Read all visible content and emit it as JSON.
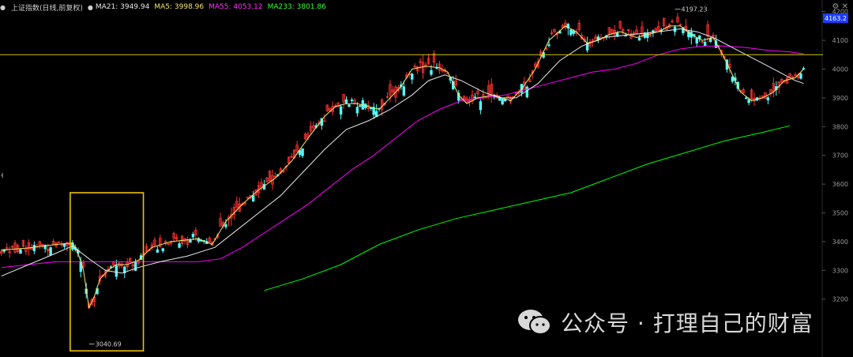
{
  "header": {
    "title": "上证指数(日线,前复权)",
    "ma21": "MA21: 3949.94",
    "ma5": "MA5: 3998.96",
    "ma55": "MA55: 4053.12",
    "ma233": "MA233: 3801.86"
  },
  "colors": {
    "background": "#000000",
    "up": "#ff3232",
    "down": "#54ffff",
    "ma5": "#f3e66c",
    "ma21": "#e8e8e8",
    "ma55": "#ff00ff",
    "ma233": "#00ff00",
    "hline": "#d6c900",
    "box": "#f0c000",
    "price_badge": "#1b3dff"
  },
  "watermark": "公众号 · 打理自己的财富",
  "chart_data": {
    "type": "candlestick",
    "title": "上证指数(日线,前复权)",
    "y_ticks": [
      3200,
      3300,
      3400,
      3500,
      3600,
      3700,
      3800,
      3900,
      4000,
      4100,
      4200
    ],
    "ylim": [
      3130,
      4230
    ],
    "current_price": "4163.2",
    "horizontal_line": 4050,
    "annotations": [
      {
        "text": "4197.23",
        "x": 246,
        "value": 4197.23
      },
      {
        "text": "3040.69",
        "x": 32,
        "value": 3040.69
      }
    ],
    "highlight_box": {
      "x_start": 26,
      "x_end": 51,
      "y_low": 3020,
      "y_high": 3570
    },
    "ma5_path": [
      [
        0,
        3370
      ],
      [
        10,
        3378
      ],
      [
        20,
        3390
      ],
      [
        26,
        3395
      ],
      [
        28,
        3360
      ],
      [
        30,
        3300
      ],
      [
        32,
        3170
      ],
      [
        34,
        3210
      ],
      [
        36,
        3270
      ],
      [
        39,
        3300
      ],
      [
        42,
        3320
      ],
      [
        46,
        3320
      ],
      [
        50,
        3335
      ],
      [
        55,
        3380
      ],
      [
        62,
        3400
      ],
      [
        72,
        3410
      ],
      [
        77,
        3390
      ],
      [
        82,
        3470
      ],
      [
        88,
        3530
      ],
      [
        94,
        3580
      ],
      [
        100,
        3620
      ],
      [
        106,
        3680
      ],
      [
        112,
        3760
      ],
      [
        118,
        3835
      ],
      [
        122,
        3870
      ],
      [
        126,
        3880
      ],
      [
        130,
        3880
      ],
      [
        134,
        3870
      ],
      [
        138,
        3860
      ],
      [
        142,
        3900
      ],
      [
        146,
        3940
      ],
      [
        150,
        4000
      ],
      [
        155,
        4010
      ],
      [
        160,
        4005
      ],
      [
        163,
        3990
      ],
      [
        167,
        3910
      ],
      [
        170,
        3880
      ],
      [
        174,
        3900
      ],
      [
        180,
        3910
      ],
      [
        186,
        3890
      ],
      [
        190,
        3930
      ],
      [
        195,
        4000
      ],
      [
        200,
        4100
      ],
      [
        206,
        4150
      ],
      [
        210,
        4130
      ],
      [
        214,
        4090
      ],
      [
        218,
        4100
      ],
      [
        222,
        4120
      ],
      [
        226,
        4130
      ],
      [
        232,
        4110
      ],
      [
        240,
        4130
      ],
      [
        244,
        4150
      ],
      [
        248,
        4150
      ],
      [
        252,
        4120
      ],
      [
        256,
        4100
      ],
      [
        260,
        4110
      ],
      [
        264,
        4040
      ],
      [
        266,
        4000
      ],
      [
        270,
        3920
      ],
      [
        274,
        3890
      ],
      [
        278,
        3900
      ],
      [
        282,
        3920
      ],
      [
        286,
        3960
      ],
      [
        290,
        3970
      ],
      [
        293,
        4000
      ]
    ],
    "ma21_path": [
      [
        0,
        3280
      ],
      [
        10,
        3320
      ],
      [
        20,
        3360
      ],
      [
        26,
        3385
      ],
      [
        32,
        3340
      ],
      [
        38,
        3300
      ],
      [
        44,
        3290
      ],
      [
        50,
        3310
      ],
      [
        58,
        3330
      ],
      [
        68,
        3350
      ],
      [
        78,
        3380
      ],
      [
        86,
        3440
      ],
      [
        94,
        3500
      ],
      [
        102,
        3560
      ],
      [
        110,
        3640
      ],
      [
        118,
        3720
      ],
      [
        126,
        3790
      ],
      [
        134,
        3820
      ],
      [
        142,
        3860
      ],
      [
        150,
        3910
      ],
      [
        156,
        3960
      ],
      [
        162,
        3980
      ],
      [
        168,
        3960
      ],
      [
        176,
        3920
      ],
      [
        182,
        3900
      ],
      [
        188,
        3900
      ],
      [
        196,
        3950
      ],
      [
        204,
        4030
      ],
      [
        212,
        4080
      ],
      [
        220,
        4110
      ],
      [
        230,
        4120
      ],
      [
        240,
        4130
      ],
      [
        248,
        4140
      ],
      [
        254,
        4130
      ],
      [
        260,
        4110
      ],
      [
        266,
        4080
      ],
      [
        272,
        4050
      ],
      [
        278,
        4020
      ],
      [
        284,
        3990
      ],
      [
        290,
        3960
      ],
      [
        293,
        3950
      ]
    ],
    "ma55_path": [
      [
        0,
        3310
      ],
      [
        10,
        3320
      ],
      [
        20,
        3330
      ],
      [
        30,
        3330
      ],
      [
        40,
        3330
      ],
      [
        50,
        3330
      ],
      [
        60,
        3330
      ],
      [
        72,
        3330
      ],
      [
        80,
        3340
      ],
      [
        88,
        3380
      ],
      [
        96,
        3430
      ],
      [
        104,
        3480
      ],
      [
        112,
        3530
      ],
      [
        120,
        3590
      ],
      [
        128,
        3650
      ],
      [
        136,
        3700
      ],
      [
        144,
        3760
      ],
      [
        152,
        3820
      ],
      [
        160,
        3860
      ],
      [
        168,
        3890
      ],
      [
        176,
        3900
      ],
      [
        184,
        3910
      ],
      [
        192,
        3930
      ],
      [
        200,
        3950
      ],
      [
        208,
        3970
      ],
      [
        216,
        3990
      ],
      [
        224,
        4000
      ],
      [
        232,
        4020
      ],
      [
        240,
        4050
      ],
      [
        248,
        4070
      ],
      [
        256,
        4080
      ],
      [
        264,
        4080
      ],
      [
        272,
        4075
      ],
      [
        280,
        4065
      ],
      [
        288,
        4060
      ],
      [
        293,
        4053
      ]
    ],
    "ma233_path": [
      [
        96,
        3230
      ],
      [
        110,
        3270
      ],
      [
        124,
        3320
      ],
      [
        138,
        3390
      ],
      [
        152,
        3440
      ],
      [
        166,
        3480
      ],
      [
        180,
        3510
      ],
      [
        194,
        3540
      ],
      [
        208,
        3570
      ],
      [
        222,
        3620
      ],
      [
        236,
        3670
      ],
      [
        250,
        3710
      ],
      [
        264,
        3750
      ],
      [
        278,
        3780
      ],
      [
        288,
        3803
      ]
    ]
  }
}
